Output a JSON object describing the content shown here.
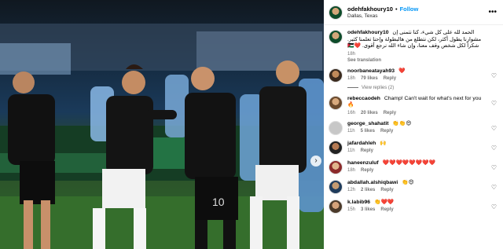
{
  "post": {
    "username": "odehfakhoury10",
    "separator": "•",
    "follow_label": "Follow",
    "location": "Dallas, Texas",
    "more_icon": "more-horizontal-icon"
  },
  "caption": {
    "username": "odehfakhoury10",
    "text": "الحمد لله على كل شيء، كنا نتمنى إن مشوارنا يطول أكثر، لكن نتطلع من هالبطولة وإحنا تعلمنا كثير. شكراً لكل شخص وقف معنا، وإن شاء الله نرجع أقوى. ❤️🇯🇴",
    "time": "18h",
    "translation_label": "See translation"
  },
  "comments": [
    {
      "username": "noorbaneatayah93",
      "text": "❤️",
      "time": "18h",
      "likes": "79 likes",
      "reply": "Reply",
      "view_replies": "View replies (2)"
    },
    {
      "username": "rebeccaodeh",
      "text": "Champ! Can't wait for what's next for you 🔥",
      "time": "16h",
      "likes": "20 likes",
      "reply": "Reply"
    },
    {
      "username": "george_shahatit",
      "text": "👏👏😍",
      "time": "11h",
      "likes": "5 likes",
      "reply": "Reply"
    },
    {
      "username": "jafardahleh",
      "text": "🙌",
      "time": "11h",
      "likes": "",
      "reply": "Reply"
    },
    {
      "username": "haneenzuluf",
      "text": "❤️❤️❤️❤️❤️❤️❤️❤️",
      "time": "18h",
      "likes": "",
      "reply": "Reply"
    },
    {
      "username": "abdallah.alshiqbawi",
      "text": "👏😍",
      "time": "12h",
      "likes": "2 likes",
      "reply": "Reply"
    },
    {
      "username": "k.labib96",
      "text": "👏❤️❤️",
      "time": "15h",
      "likes": "3 likes",
      "reply": "Reply"
    }
  ],
  "colors": {
    "accent": "#0095f6",
    "heart": "#ed4956"
  }
}
